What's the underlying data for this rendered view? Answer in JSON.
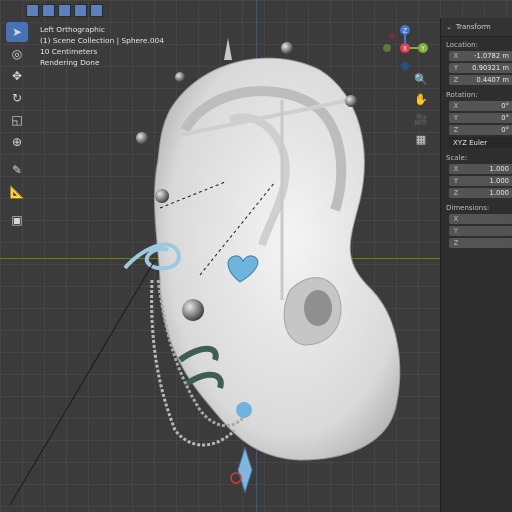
{
  "viewport_info": {
    "view": "Left Orthographic",
    "collection": "(1) Scene Collection | Sphere.004",
    "scale": "10 Centimeters",
    "status": "Rendering Done"
  },
  "gizmo": {
    "x": "X",
    "y": "Y",
    "z": "Z"
  },
  "toolbar": {
    "tools": [
      "select-box",
      "cursor",
      "move",
      "rotate",
      "scale",
      "transform",
      "annotate",
      "measure",
      "add-cube"
    ]
  },
  "transform_panel": {
    "title": "Transform",
    "location_label": "Location:",
    "location": [
      {
        "axis": "X",
        "value": "-1.0782 m"
      },
      {
        "axis": "Y",
        "value": "0.90321 m"
      },
      {
        "axis": "Z",
        "value": "0.4407 m"
      }
    ],
    "rotation_label": "Rotation:",
    "rotation": [
      {
        "axis": "X",
        "value": "0°"
      },
      {
        "axis": "Y",
        "value": "0°"
      },
      {
        "axis": "Z",
        "value": "0°"
      }
    ],
    "rotation_mode": "XYZ Euler",
    "scale_label": "Scale:",
    "scale": [
      {
        "axis": "X",
        "value": "1.000"
      },
      {
        "axis": "Y",
        "value": "1.000"
      },
      {
        "axis": "Z",
        "value": "1.000"
      }
    ],
    "dimensions_label": "Dimensions:",
    "dimensions": [
      {
        "axis": "X",
        "value": ""
      },
      {
        "axis": "Y",
        "value": ""
      },
      {
        "axis": "Z",
        "value": ""
      }
    ]
  },
  "colors": {
    "accent": "#4772b3",
    "x_axis": "#e0404a",
    "y_axis": "#7fb13c",
    "z_axis": "#3a7bd8",
    "ear": "#e8e8e8",
    "gem": "#6fb4dd"
  }
}
